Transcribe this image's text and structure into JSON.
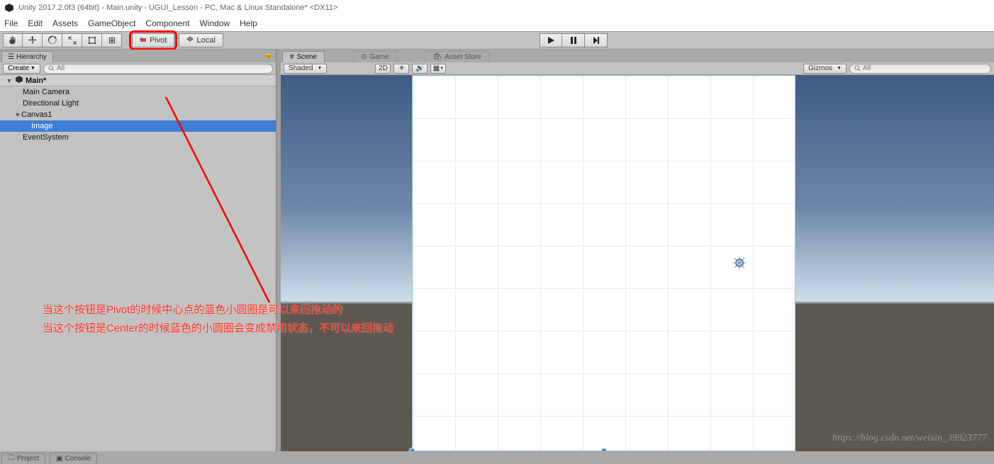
{
  "window": {
    "title": "Unity 2017.2.0f3 (64bit) - Main.unity - UGUI_Lesson - PC, Mac & Linux Standalone* <DX11>"
  },
  "menu": {
    "file": "File",
    "edit": "Edit",
    "assets": "Assets",
    "gameObject": "GameObject",
    "component": "Component",
    "window": "Window",
    "help": "Help"
  },
  "toolbar": {
    "pivot": "Pivot",
    "local": "Local"
  },
  "hierarchy": {
    "tab": "Hierarchy",
    "create": "Create",
    "searchPlaceholder": "All",
    "scene": "Main*",
    "items": [
      "Main Camera",
      "Directional Light",
      "Canvas1",
      "Image",
      "EventSystem"
    ]
  },
  "scene": {
    "tabScene": "Scene",
    "tabGame": "Game",
    "tabAssetStore": "Asset Store",
    "shaded": "Shaded",
    "twoD": "2D",
    "gizmos": "Gizmos",
    "searchPlaceholder": "All"
  },
  "bottom": {
    "project": "Project",
    "console": "Console"
  },
  "annotation": {
    "line1": "当这个按钮是Pivot的时候中心点的蓝色小圆圈是可以来回拖动的",
    "line2": "当这个按钮是Center的时候蓝色的小圆圈会变成禁用状态，不可以来回拖动"
  },
  "watermark": "https://blog.csdn.net/weixin_39923777"
}
